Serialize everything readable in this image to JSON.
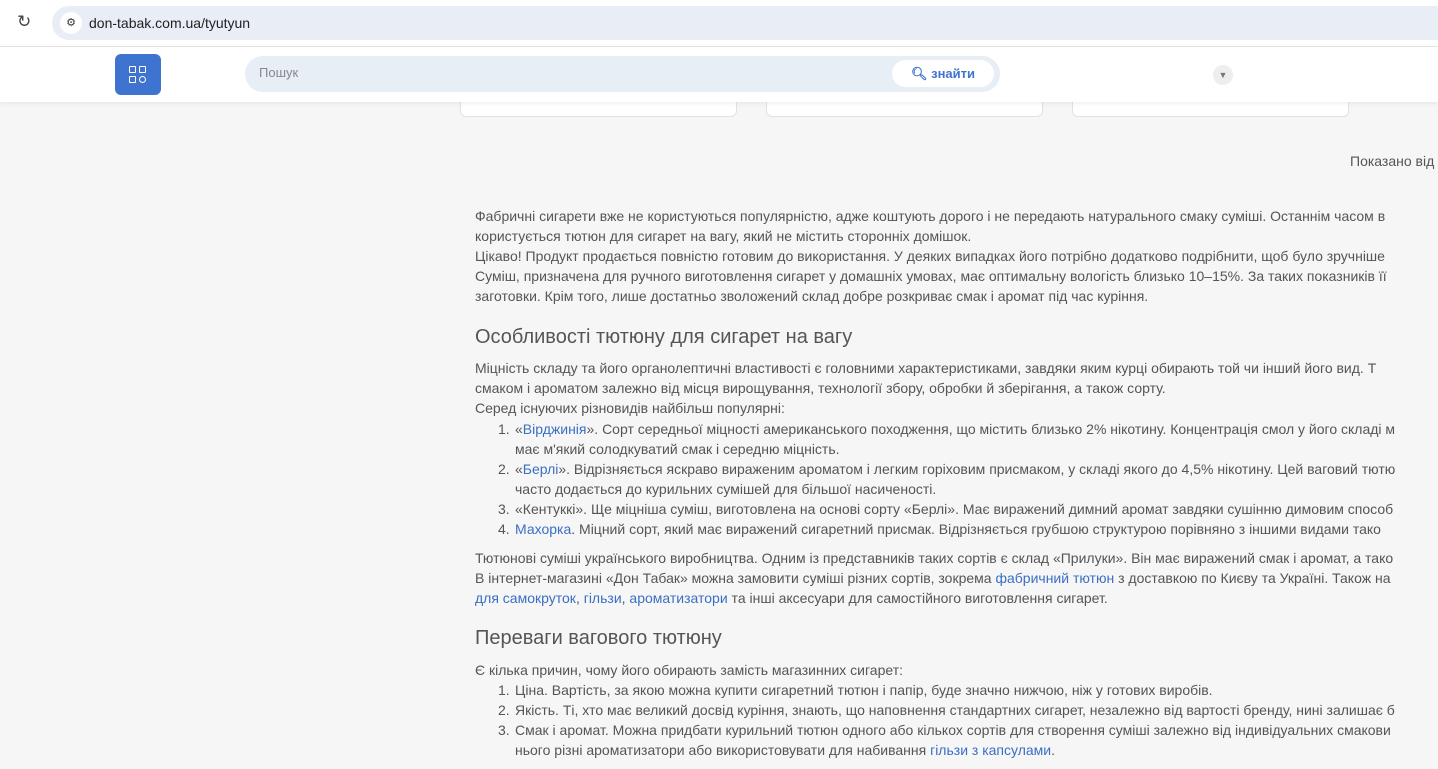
{
  "browser": {
    "url": "don-tabak.com.ua/tyutyun"
  },
  "header": {
    "search_placeholder": "Пошук",
    "search_button": "знайти"
  },
  "shown_text": "Показано від",
  "content": {
    "intro": [
      [
        {
          "t": "Фабричні сигарети вже не користуються популярністю, адже коштують дорого і не передають натурального смаку суміші. Останнім часом в"
        }
      ],
      [
        {
          "t": "користується тютюн для сигарет на вагу, який не містить сторонніх домішок."
        }
      ],
      [
        {
          "t": "Цікаво! Продукт продається повністю готовим до використання. У деяких випадках його потрібно додатково подрібнити, щоб було зручніше"
        }
      ],
      [
        {
          "t": "Суміш, призначена для ручного виготовлення сигарет у домашніх умовах, має оптимальну вологість близько 10–15%. За таких показників її"
        }
      ],
      [
        {
          "t": "заготовки. Крім того, лише достатньо зволожений склад добре розкриває смак і аромат під час куріння."
        }
      ]
    ],
    "heading1": "Особливості тютюну для сигарет на вагу",
    "sec1": [
      [
        {
          "t": "Міцність складу та його органолептичні властивості є головними характеристиками, завдяки яким курці обирають той чи інший його вид. Т"
        }
      ],
      [
        {
          "t": "смаком і ароматом залежно від місця вирощування, технології збору, обробки й зберігання, а також сорту."
        }
      ],
      [
        {
          "t": "Серед існуючих різновидів найбільш популярні:"
        }
      ]
    ],
    "list1": [
      {
        "num": "1.",
        "lines": [
          [
            {
              "t": "«"
            },
            {
              "t": "Вірджинія",
              "link": true
            },
            {
              "t": "». Сорт середньої міцності американського походження, що містить близько 2% нікотину. Концентрація смол у його складі м"
            }
          ],
          [
            {
              "t": "має м'який солодкуватий смак і середню міцність."
            }
          ]
        ]
      },
      {
        "num": "2.",
        "lines": [
          [
            {
              "t": "«"
            },
            {
              "t": "Берлі",
              "link": true
            },
            {
              "t": "». Відрізняється яскраво вираженим ароматом і легким горіховим присмаком, у складі якого до 4,5% нікотину. Цей ваговий тютю"
            }
          ],
          [
            {
              "t": "часто додається до курильних сумішей для більшої насиченості."
            }
          ]
        ]
      },
      {
        "num": "3.",
        "lines": [
          [
            {
              "t": "«Кентуккі». Ще міцніша суміш, виготовлена на основі сорту «Берлі». Має виражений димний аромат завдяки сушінню димовим способ"
            }
          ]
        ]
      },
      {
        "num": "4.",
        "lines": [
          [
            {
              "t": "Махорка",
              "link": true
            },
            {
              "t": ". Міцний сорт, який має виражений сигаретний присмак. Відрізняється грубшою структурою порівняно з іншими видами тако"
            }
          ]
        ]
      }
    ],
    "sec2": [
      [
        {
          "t": "Тютюнові суміші українського виробництва. Одним із представників таких сортів є склад «Прилуки». Він має виражений смак і аромат, а тако"
        }
      ],
      [
        {
          "t": "В інтернет-магазині «Дон Табак» можна замовити суміші різних сортів, зокрема "
        },
        {
          "t": "фабричний тютюн",
          "link": true
        },
        {
          "t": " з доставкою по Києву та Україні. Також на"
        }
      ],
      [
        {
          "t": "для самокруток",
          "link": true
        },
        {
          "t": ", "
        },
        {
          "t": "гільзи",
          "link": true
        },
        {
          "t": ", "
        },
        {
          "t": "ароматизатори",
          "link": true
        },
        {
          "t": " та інші аксесуари для самостійного виготовлення сигарет."
        }
      ]
    ],
    "heading2": "Переваги вагового тютюну",
    "sec3": [
      [
        {
          "t": "Є кілька причин, чому його обирають замість магазинних сигарет:"
        }
      ]
    ],
    "list2": [
      {
        "num": "1.",
        "lines": [
          [
            {
              "t": "Ціна. Вартість, за якою можна купити сигаретний тютюн і папір, буде значно нижчою, ніж у готових виробів."
            }
          ]
        ]
      },
      {
        "num": "2.",
        "lines": [
          [
            {
              "t": "Якість. Ті, хто має великий досвід куріння, знають, що наповнення стандартних сигарет, незалежно від вартості бренду, нині залишає б"
            }
          ]
        ]
      },
      {
        "num": "3.",
        "lines": [
          [
            {
              "t": "Смак і аромат. Можна придбати курильний тютюн одного або кількох сортів для створення суміші залежно від індивідуальних смакови"
            }
          ],
          [
            {
              "t": "нього різні ароматизатори або використовувати для набивання "
            },
            {
              "t": "гільзи з капсулами",
              "link": true
            },
            {
              "t": "."
            }
          ]
        ]
      }
    ]
  }
}
